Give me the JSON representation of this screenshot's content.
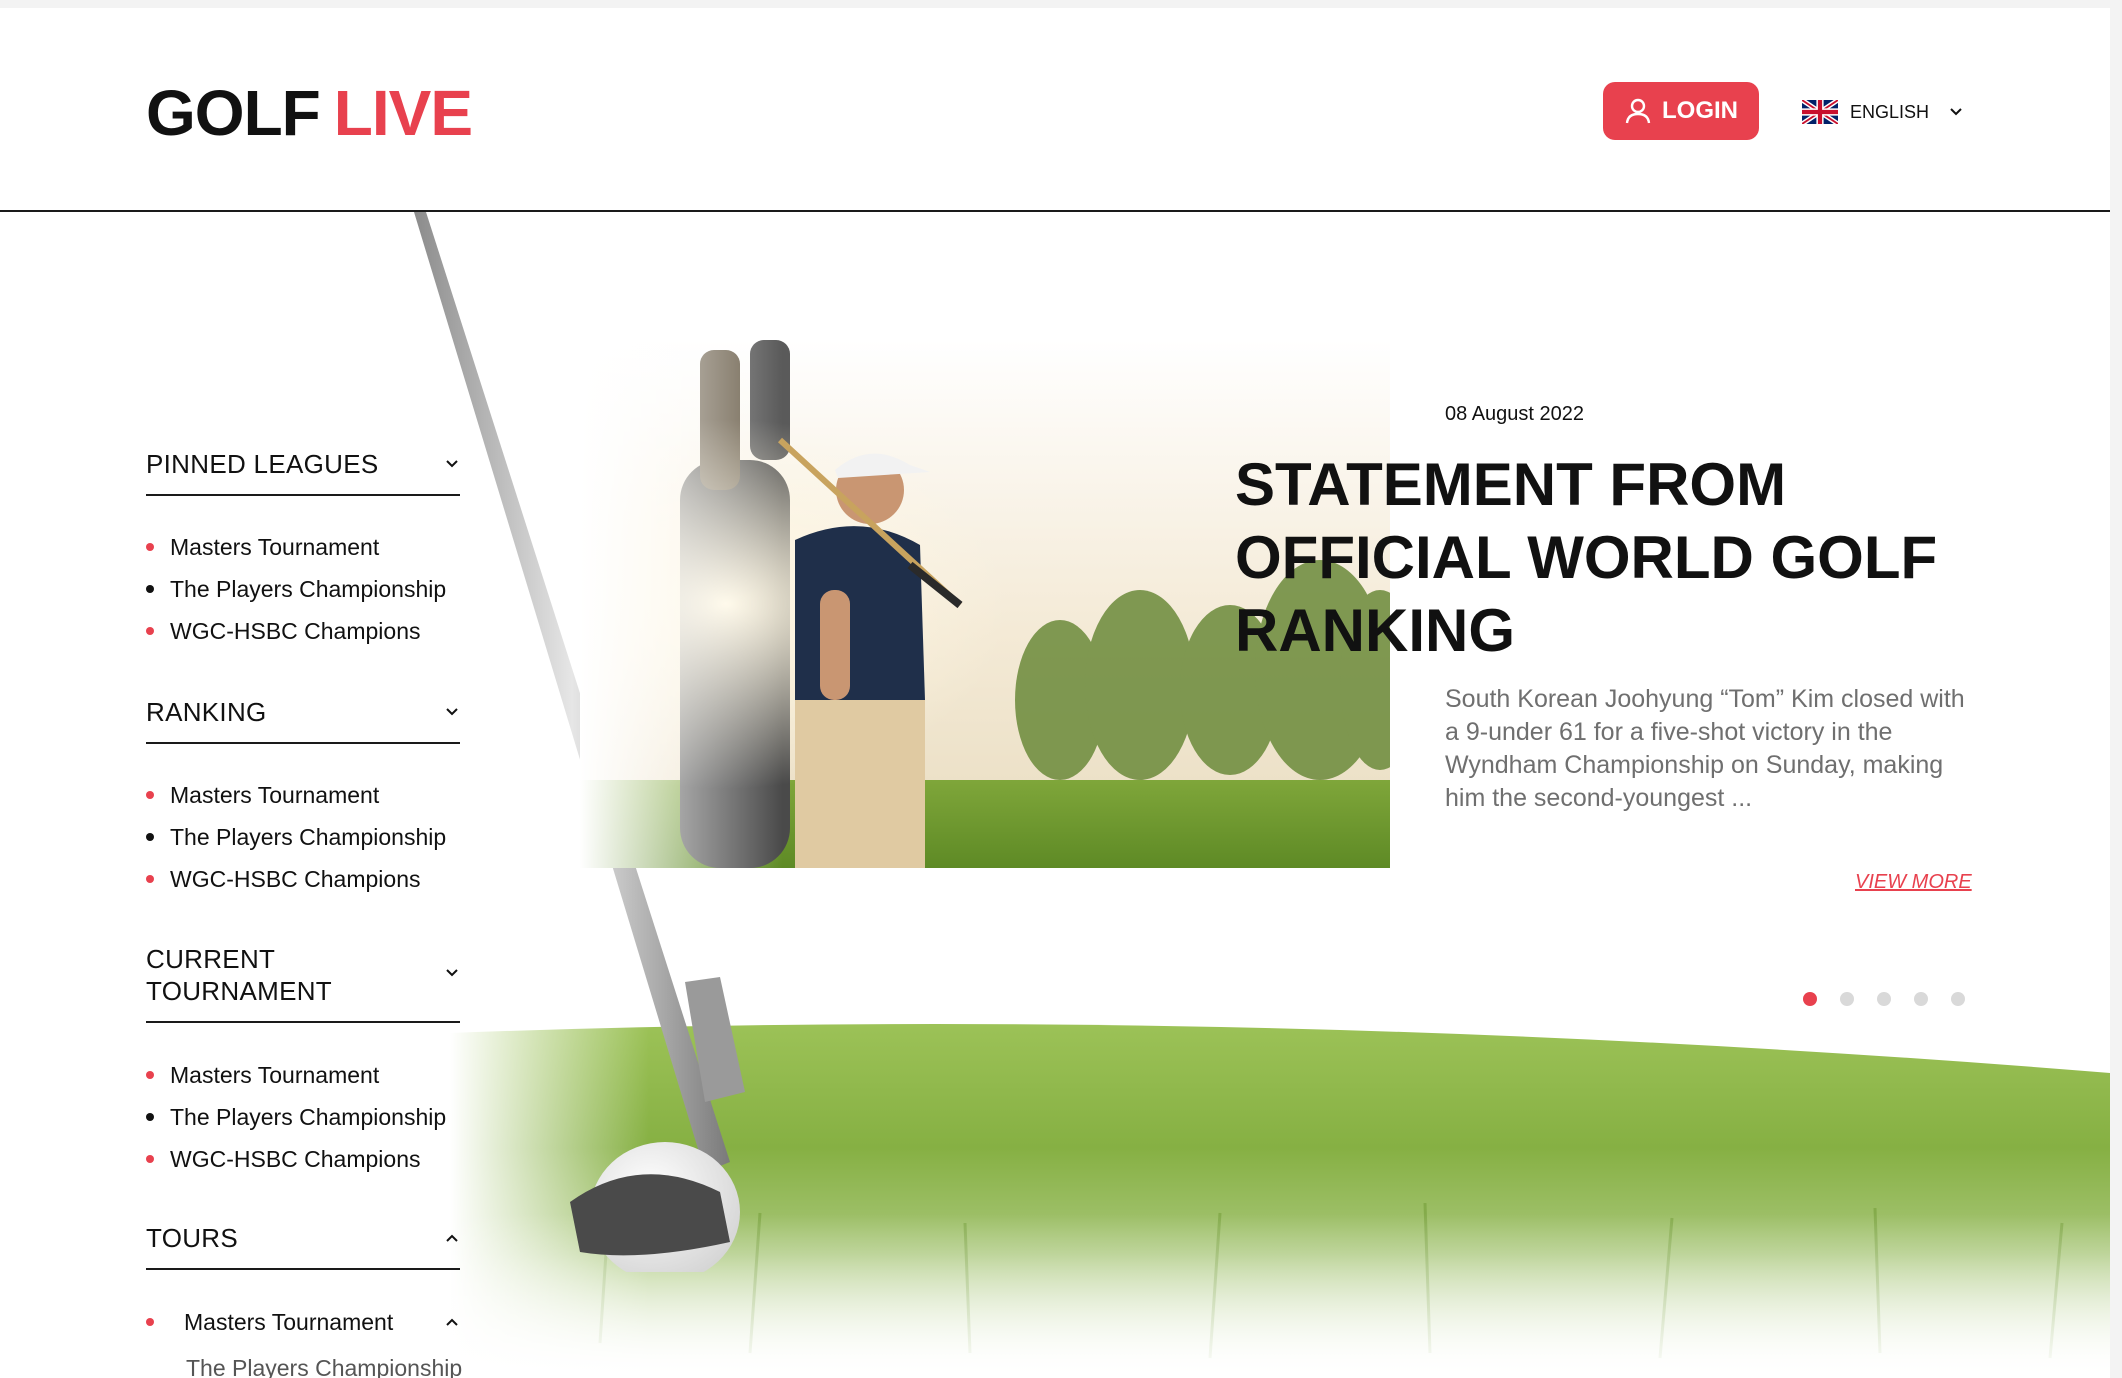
{
  "header": {
    "logo_part1": "GOLF",
    "logo_part2": "LIVE",
    "login_label": "LOGIN",
    "language_label": "ENGLISH"
  },
  "sidebar": {
    "sections": [
      {
        "title": "PINNED LEAGUES",
        "expanded": false,
        "items": [
          "Masters Tournament",
          "The Players Championship",
          "WGC-HSBC Champions"
        ]
      },
      {
        "title": "RANKING",
        "expanded": false,
        "items": [
          "Masters Tournament",
          "The Players Championship",
          "WGC-HSBC Champions"
        ]
      },
      {
        "title": "CURRENT TOURNAMENT",
        "title_line1": "CURRENT",
        "title_line2": "TOURNAMENT",
        "expanded": false,
        "items": [
          "Masters Tournament",
          "The Players Championship",
          "WGC-HSBC Champions"
        ]
      },
      {
        "title": "TOURS",
        "expanded": true,
        "items": [
          "Masters Tournament"
        ],
        "sub_items": [
          "The Players Championship"
        ]
      }
    ]
  },
  "article": {
    "date": "08 August 2022",
    "title_line1": "STATEMENT FROM",
    "title_line2": "OFFICIAL WORLD GOLF",
    "title_line3": "RANKING",
    "excerpt": "South Korean Joohyung “Tom” Kim closed with a 9-under 61 for a five-shot victory in the Wyndham Championship on Sunday, making him the second-youngest ...",
    "view_more_label": "VIEW MORE"
  },
  "carousel": {
    "total": 5,
    "active_index": 0
  },
  "colors": {
    "accent": "#e8414e",
    "text": "#111111",
    "muted": "#6f6f6f",
    "divider": "#1a1a1a",
    "dot_inactive": "#d9d9d9"
  },
  "icons": {
    "login": "user-icon",
    "language": "uk-flag-icon",
    "expand": "chevron-down-icon",
    "collapse": "chevron-up-icon"
  }
}
